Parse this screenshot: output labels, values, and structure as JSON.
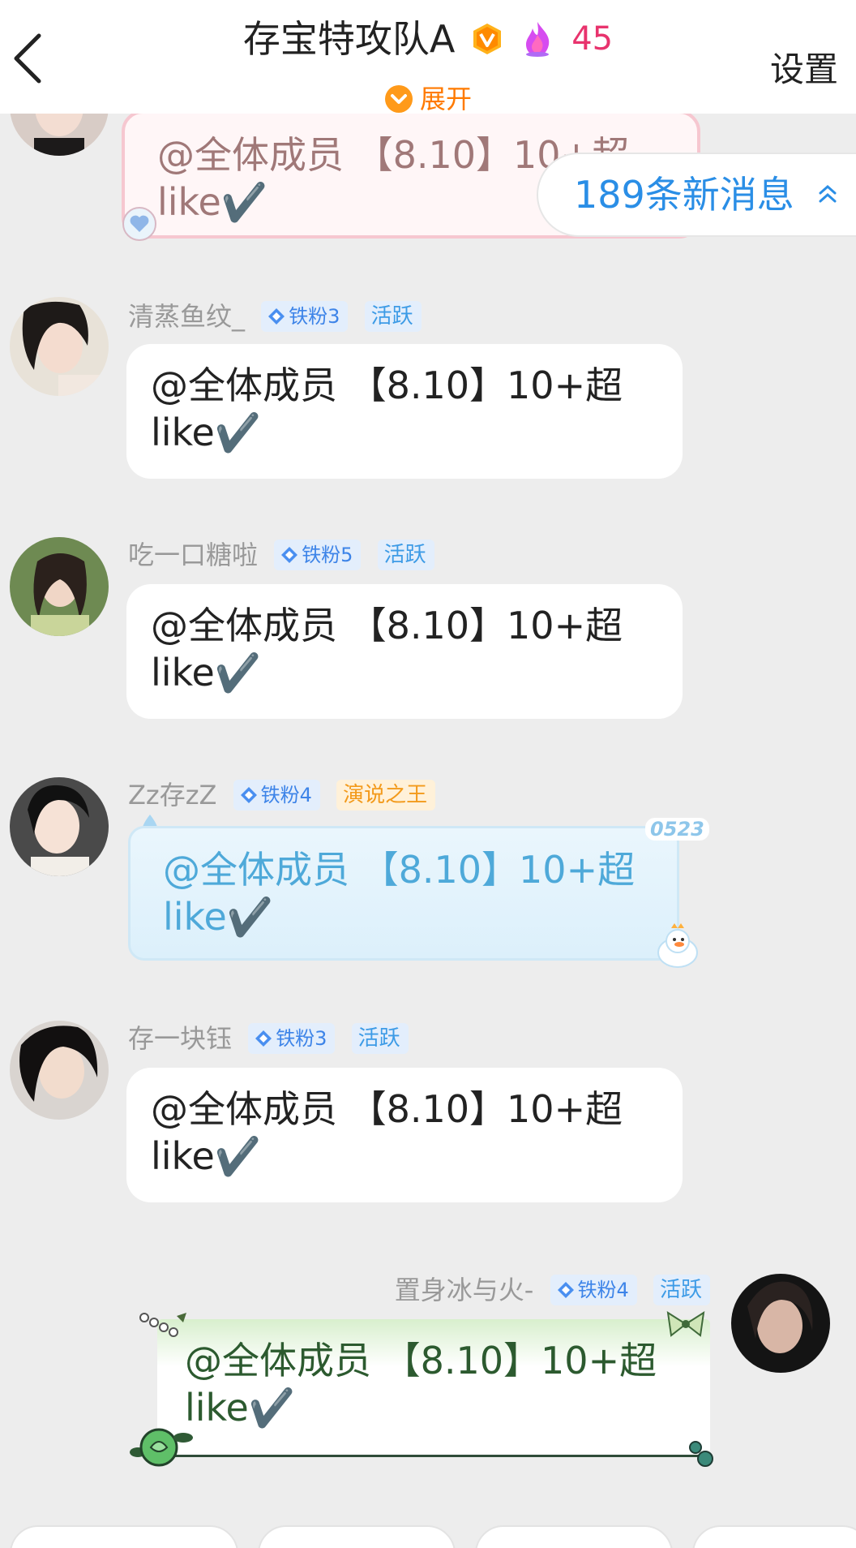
{
  "header": {
    "title": "存宝特攻队A",
    "level": "45",
    "settings_label": "设置",
    "expand_label": "展开"
  },
  "new_messages": {
    "label": "189条新消息"
  },
  "messages": [
    {
      "name": "",
      "text": "@全体成员 【8.10】10+超like✔️",
      "text_line1": "@全体成员 【8.10】10+超",
      "text_line2": "like✔️",
      "style": "pink"
    },
    {
      "name": "清蒸鱼纹_",
      "fan_badge": "铁粉3",
      "role_badge": "活跃",
      "text_line1": "@全体成员 【8.10】10+超",
      "text_line2": "like✔️",
      "style": "default"
    },
    {
      "name": "吃一口糖啦",
      "fan_badge": "铁粉5",
      "role_badge": "活跃",
      "text_line1": "@全体成员 【8.10】10+超",
      "text_line2": "like✔️",
      "style": "default"
    },
    {
      "name": "Zz存zZ",
      "fan_badge": "铁粉4",
      "role_badge": "演说之王",
      "text_line1": "@全体成员 【8.10】10+超",
      "text_line2": "like✔️",
      "style": "blue",
      "decor_text": "0523"
    },
    {
      "name": "存一块钰",
      "fan_badge": "铁粉3",
      "role_badge": "活跃",
      "text_line1": "@全体成员 【8.10】10+超",
      "text_line2": "like✔️",
      "style": "default"
    },
    {
      "name": "置身冰与火-",
      "fan_badge": "铁粉4",
      "role_badge": "活跃",
      "text_line1": "@全体成员 【8.10】10+超",
      "text_line2": "like✔️",
      "style": "green"
    }
  ],
  "colors": {
    "accent_orange": "#ff7a00",
    "level_pink": "#e8336d",
    "link_blue": "#2a8ee6",
    "badge_blue": "#3d84e8",
    "badge_gold": "#f39a1b"
  },
  "icons": [
    "back-arrow-icon",
    "vip-badge-icon",
    "fire-icon",
    "chevron-down-circle-icon",
    "double-chevron-up-icon",
    "diamond-icon"
  ]
}
